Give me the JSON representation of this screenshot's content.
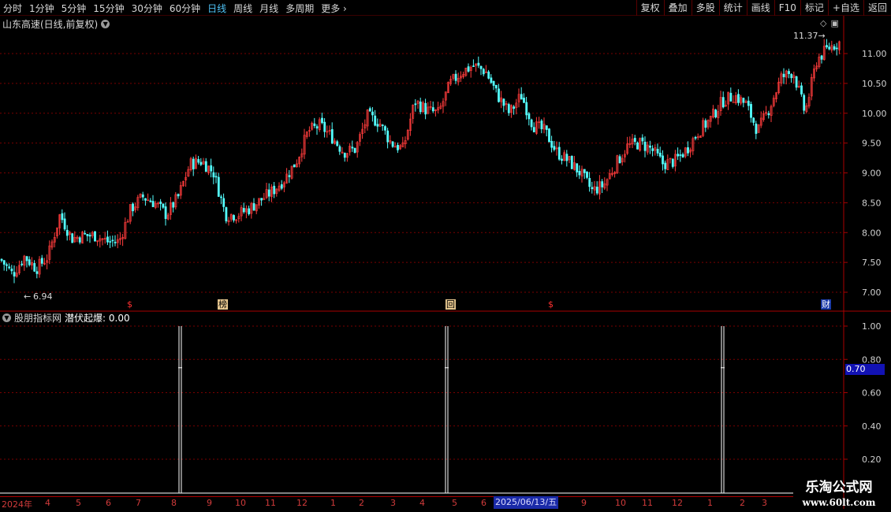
{
  "toolbar": {
    "tabs": [
      {
        "label": "分时",
        "active": false
      },
      {
        "label": "1分钟",
        "active": false
      },
      {
        "label": "5分钟",
        "active": false
      },
      {
        "label": "15分钟",
        "active": false
      },
      {
        "label": "30分钟",
        "active": false
      },
      {
        "label": "60分钟",
        "active": false
      },
      {
        "label": "日线",
        "active": true
      },
      {
        "label": "周线",
        "active": false
      },
      {
        "label": "月线",
        "active": false
      },
      {
        "label": "多周期",
        "active": false
      },
      {
        "label": "更多 ›",
        "active": false
      }
    ],
    "tools": [
      "复权",
      "叠加",
      "多股",
      "统计",
      "画线",
      "F10",
      "标记",
      "+自选",
      "返回"
    ]
  },
  "main_chart": {
    "title": "山东高速(日线,前复权)",
    "high_label": "11.37",
    "low_label": "6.94",
    "markers": [
      {
        "text": "$",
        "style": "red"
      },
      {
        "text": "榜",
        "style": "box"
      },
      {
        "text": "回",
        "style": "box"
      },
      {
        "text": "$",
        "style": "red"
      },
      {
        "text": "财",
        "style": "blue"
      }
    ],
    "colors": {
      "up": "#ff3c3c",
      "down": "#54ffff",
      "grid": "#7a0000",
      "axis": "#aa0000"
    }
  },
  "indicator": {
    "name": "股朋指标网",
    "label": "潜伏起爆: 0.00",
    "current_value": "0.70"
  },
  "date_axis": {
    "ticks": [
      "2024年",
      "4",
      "5",
      "6",
      "7",
      "8",
      "9",
      "10",
      "11",
      "12",
      "1",
      "2",
      "3",
      "4",
      "5",
      "6",
      "9",
      "10",
      "11",
      "12",
      "1",
      "2",
      "3"
    ],
    "selected": "2025/06/13/五"
  },
  "watermark": {
    "line1": "乐淘公式网",
    "line2": "www.60lt.com"
  },
  "chart_data": [
    {
      "type": "candlestick",
      "title": "山东高速(日线,前复权)",
      "y_axis_ticks": [
        "11.00",
        "10.50",
        "10.00",
        "9.50",
        "9.00",
        "8.50",
        "8.00",
        "7.50",
        "7.00"
      ],
      "ylim": [
        6.8,
        11.5
      ],
      "x": [
        0,
        15,
        30,
        45,
        60,
        75,
        90,
        105,
        120,
        135,
        150,
        165,
        180,
        195,
        210,
        225,
        240,
        255,
        270,
        285,
        300,
        315,
        330,
        345,
        360,
        375,
        390,
        405,
        420,
        435,
        450,
        465,
        480,
        495,
        510,
        525,
        540,
        555,
        570,
        585,
        600,
        615,
        630,
        645,
        660,
        675,
        690,
        705,
        720,
        735,
        750,
        765,
        780,
        795,
        810,
        825,
        840,
        855,
        870,
        885,
        900,
        915,
        930,
        945,
        960,
        975,
        990,
        1005,
        1020,
        1035,
        1050,
        1065
      ],
      "close": [
        7.55,
        7.3,
        7.6,
        7.4,
        7.6,
        8.3,
        7.9,
        7.95,
        7.95,
        7.85,
        7.85,
        8.4,
        8.6,
        8.5,
        8.3,
        8.6,
        9.15,
        9.2,
        9.0,
        8.3,
        8.3,
        8.4,
        8.55,
        8.7,
        8.9,
        9.2,
        9.7,
        9.8,
        9.6,
        9.35,
        9.4,
        9.95,
        9.85,
        9.5,
        9.4,
        10.2,
        10.05,
        10.0,
        10.5,
        10.7,
        10.8,
        10.7,
        10.3,
        10.0,
        10.3,
        9.8,
        9.7,
        9.35,
        9.2,
        9.0,
        8.7,
        8.8,
        9.15,
        9.45,
        9.5,
        9.4,
        9.15,
        9.2,
        9.4,
        9.7,
        9.9,
        10.2,
        10.3,
        10.15,
        9.7,
        10.1,
        10.6,
        10.7,
        10.0,
        10.9,
        11.1,
        11.2
      ],
      "low_annotation": 6.94,
      "high_annotation": 11.37
    },
    {
      "type": "bar",
      "title": "潜伏起爆",
      "y_axis_ticks": [
        "1.00",
        "0.80",
        "0.60",
        "0.40",
        "0.20"
      ],
      "ylim": [
        0,
        1.1
      ],
      "signals": [
        {
          "date_index": "2024-08",
          "value": 1.0
        },
        {
          "date_index": "2025-05",
          "value": 1.0
        },
        {
          "date_index": "2025-12",
          "value": 1.0
        }
      ]
    }
  ]
}
